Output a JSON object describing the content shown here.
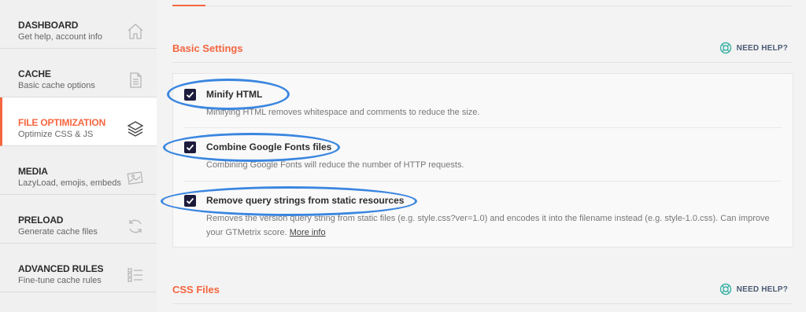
{
  "sidebar": {
    "items": [
      {
        "title": "DASHBOARD",
        "subtitle": "Get help, account info",
        "icon": "home-icon"
      },
      {
        "title": "CACHE",
        "subtitle": "Basic cache options",
        "icon": "page-icon"
      },
      {
        "title": "FILE OPTIMIZATION",
        "subtitle": "Optimize CSS & JS",
        "icon": "layers-icon"
      },
      {
        "title": "MEDIA",
        "subtitle": "LazyLoad, emojis, embeds",
        "icon": "image-icon"
      },
      {
        "title": "PRELOAD",
        "subtitle": "Generate cache files",
        "icon": "refresh-icon"
      },
      {
        "title": "ADVANCED RULES",
        "subtitle": "Fine-tune cache rules",
        "icon": "list-icon"
      }
    ],
    "active": "FILE OPTIMIZATION"
  },
  "basic": {
    "title": "Basic Settings",
    "help": "NEED HELP?",
    "options": [
      {
        "label": "Minify HTML",
        "desc": "Minifying HTML removes whitespace and comments to reduce the size.",
        "checked": true
      },
      {
        "label": "Combine Google Fonts files",
        "desc": "Combining Google Fonts will reduce the number of HTTP requests.",
        "checked": true
      },
      {
        "label": "Remove query strings from static resources",
        "desc": "Removes the version query string from static files (e.g. style.css?ver=1.0) and encodes it into the filename instead (e.g. style-1.0.css). Can improve your GTMetrix score.",
        "link": "More info",
        "checked": true
      }
    ]
  },
  "css": {
    "title": "CSS Files",
    "help": "NEED HELP?"
  },
  "colors": {
    "accent": "#f56640",
    "checkbox": "#1d1b3c",
    "annotation": "#3a86e0"
  }
}
